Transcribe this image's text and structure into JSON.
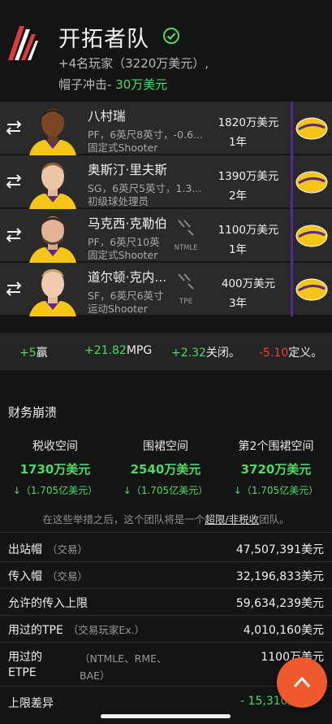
{
  "header": {
    "team_name": "开拓者队",
    "summary": "+4名玩家（3220万美元）,",
    "hard_cap_label": "帽子冲击-",
    "hard_cap_value": "30万美元"
  },
  "players": [
    {
      "name": "八村瑞",
      "desc1": "PF，6英尺8英寸，-0.6...",
      "desc2": "固定式Shooter",
      "salary": "1820万美元",
      "years": "1年",
      "exception": ""
    },
    {
      "name": "奥斯汀·里夫斯",
      "desc1": "SG，6英尺5英寸，1.3...",
      "desc2": "初级球处理员",
      "salary": "1390万美元",
      "years": "2年",
      "exception": ""
    },
    {
      "name": "马克西·克勒伯",
      "desc1": "PF，6英尺10英",
      "desc2": "固定式Shooter",
      "salary": "1100万美元",
      "years": "1年",
      "exception": "NTMLE"
    },
    {
      "name": "道尔顿·克内...",
      "desc1": "SF，6英尺6英寸",
      "desc2": "运动Shooter",
      "salary": "400万美元",
      "years": "3年",
      "exception": "TPE"
    }
  ],
  "stats": {
    "wins_value": "+5",
    "wins_label": "赢",
    "mpg_value": "+21.82",
    "mpg_label": "MPG",
    "close_value": "+2.32",
    "close_label": "关闭。",
    "def_value": "-5.10",
    "def_label": "定义。"
  },
  "finances": {
    "title": "财务崩溃",
    "spaces": [
      {
        "label": "税收空间",
        "value": "1730万美元",
        "sub": "↓（1.705亿美元）"
      },
      {
        "label": "围裙空间",
        "value": "2540万美元",
        "sub": "↓（1.705亿美元）"
      },
      {
        "label": "第2个围裙空间",
        "value": "3720万美元",
        "sub": "↓（1.705亿美元）"
      }
    ],
    "note_prefix": "在这些举措之后，这个团队将是一个",
    "note_highlight": "超限/非税收",
    "note_suffix": "团队。",
    "rows": [
      {
        "label": "出站帽",
        "sub": "（交易）",
        "value": "47,507,391美元"
      },
      {
        "label": "传入帽",
        "sub": "（交易）",
        "value": "32,196,833美元"
      },
      {
        "label": "允许的传入上限",
        "sub": "",
        "value": "59,634,239美元"
      },
      {
        "label": "用过的TPE",
        "sub": "（交易玩家Ex.）",
        "value": "4,010,160美元"
      },
      {
        "label": "用过的",
        "sub": "（NTMLE、RME、",
        "value": "1100万美元"
      },
      {
        "label": "ETPE",
        "sub": "BAE）",
        "value": ""
      },
      {
        "label": "上限差异",
        "sub": "",
        "value": "- 15,310,"
      }
    ]
  },
  "colors": {
    "accent_green": "#4cd964",
    "accent_red": "#ff3b30",
    "fab_orange": "#ee5a2c",
    "lakers_purple": "#5b2a86"
  }
}
